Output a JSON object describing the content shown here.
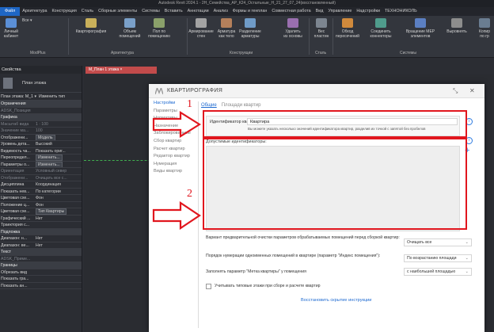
{
  "app": {
    "title": "Autodesk Revit 2024.1 - 2Н_Семейства_АР_К24_Осталъные_Н_21_27_07_24(восстановленный)",
    "tabs": [
      "Файл",
      "Архитектура",
      "Конструкция",
      "Сталь",
      "Сборные элементы",
      "Системы",
      "Вставить",
      "Аннотации",
      "Анализ",
      "Формы и генплан",
      "Совместная работа",
      "Вид",
      "Управление",
      "Надстройки",
      "ТЕХНОНИКОЛЬ"
    ]
  },
  "ribbon": {
    "buttons": [
      "Личный\nкабинет",
      "Все",
      "Квартирография",
      "Объем\nпомещений",
      "Пол по\nпомещению",
      "Армирование\nстен",
      "Арматура\nкак тело",
      "Разделение\nарматуры",
      "Удалить\nиз основы",
      "Вес\nпластин",
      "Обход\nпересечений",
      "Соединить\nконнекторы",
      "Вращение MEP\nэлементов",
      "Выровнять",
      "Копир\nпо гр"
    ],
    "groups": [
      "ModPlus",
      "Архитектура",
      "Конструкции",
      "Сталь",
      "Системы"
    ]
  },
  "properties": {
    "header": "Свойства",
    "type_name": "План этажа",
    "selector": "План этажа: М_1",
    "edit_type": "Изменить тип",
    "rows": [
      {
        "k": "Ограничения",
        "v": "",
        "sec": true
      },
      {
        "k": "ADSK_Позиция",
        "v": "",
        "dim": true
      },
      {
        "k": "Графика",
        "v": "",
        "sec": true
      },
      {
        "k": "Масштаб вида",
        "v": "1 : 100",
        "dim": true
      },
      {
        "k": "Значение ма...",
        "v": "100",
        "dim": true
      },
      {
        "k": "Отображени...",
        "v": "Модель",
        "btn": true
      },
      {
        "k": "Уровень дета...",
        "v": "Высокий"
      },
      {
        "k": "Видимость ча...",
        "v": "Показать ориг..."
      },
      {
        "k": "Переопредел...",
        "v": "Изменить...",
        "btn": true
      },
      {
        "k": "Параметры о...",
        "v": "Изменить...",
        "btn": true
      },
      {
        "k": "Ориентация",
        "v": "Условный север",
        "dim": true
      },
      {
        "k": "Отображени...",
        "v": "Очищать все с...",
        "dim": true
      },
      {
        "k": "Дисциплина",
        "v": "Координация"
      },
      {
        "k": "Показать нев...",
        "v": "По категории"
      },
      {
        "k": "Цветовая схе...",
        "v": "Фон"
      },
      {
        "k": "Положение ц...",
        "v": "Фон"
      },
      {
        "k": "Цветовая схе...",
        "v": "Тип Квартиры",
        "btn": true
      },
      {
        "k": "Графический ...",
        "v": "Нет"
      },
      {
        "k": "Траектория с...",
        "v": ""
      },
      {
        "k": "Подложка",
        "v": "",
        "sec": true
      },
      {
        "k": "Диапазон: н...",
        "v": "Нет"
      },
      {
        "k": "Диапазон: ве...",
        "v": "Нет"
      },
      {
        "k": "Текст",
        "v": "",
        "sec": true
      },
      {
        "k": "ADSK_Приме...",
        "v": "",
        "dim": true
      },
      {
        "k": "Границы",
        "v": "",
        "sec": true
      },
      {
        "k": "Обрезать вид",
        "v": ""
      },
      {
        "k": "Показать гра...",
        "v": ""
      },
      {
        "k": "Показать ан...",
        "v": ""
      }
    ]
  },
  "view_tab": "М_План 1 этажа",
  "dialog": {
    "title": "КВАРТИРОГРАФИЯ",
    "nav": [
      "Настройки",
      "Параметры",
      "Нормативы",
      "Назначение",
      "Заблокированные",
      "Сбор квартир",
      "Расчет квартир",
      "Редактор квартир",
      "Нумерация",
      "Виды квартир"
    ],
    "subtabs": [
      "Общие",
      "Площади квартир"
    ],
    "id_label": "Идентификатор квартир:",
    "id_value": "Квартира",
    "id_hint": "Вы можете указать несколько значений идентификатора квартир, разделив их точкой с запятой без пробелов",
    "allowed_label": "Допустимые идентификаторы:",
    "options": [
      {
        "label": "Вариант предварительной очистки параметров обрабатываемых помещений перед сборкой квартир:",
        "value": "Очищать все"
      },
      {
        "label": "Порядок нумерации одноименных помещений в квартире (параметр \"Индекс помещения\"):",
        "value": "По возрастанию площади"
      },
      {
        "label": "Заполнять параметр \"Метка квартиры\" у помещения",
        "value": "с наибольшей площадью"
      }
    ],
    "checkbox_label": "Учитывать типовые этажи при сборе и расчете квартир",
    "restore_link": "Восстановить скрытие инструкции"
  },
  "annotations": {
    "n1": "1",
    "n2": "2",
    "color": "#e1161e"
  }
}
